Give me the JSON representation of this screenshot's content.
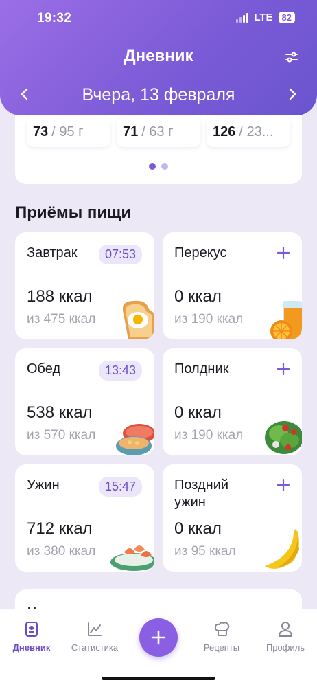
{
  "status": {
    "time": "19:32",
    "network": "LTE",
    "battery": "82"
  },
  "header": {
    "title": "Дневник",
    "date": "Вчера,  13 февраля"
  },
  "summary": {
    "nutrients": [
      {
        "value": "73",
        "goal": "/ 95 г"
      },
      {
        "value": "71",
        "goal": "/ 63 г"
      },
      {
        "value": "126",
        "goal": "/ 23..."
      }
    ]
  },
  "section_title": "Приёмы пищи",
  "meals": [
    {
      "name": "Завтрак",
      "time": "07:53",
      "kcal": "188 ккал",
      "of": "из 475 ккал",
      "picture": "toast-egg"
    },
    {
      "name": "Перекус",
      "time": "",
      "kcal": "0 ккал",
      "of": "из 190 ккал",
      "picture": "orange-juice"
    },
    {
      "name": "Обед",
      "time": "13:43",
      "kcal": "538 ккал",
      "of": "из 570 ккал",
      "picture": "soup-bowl"
    },
    {
      "name": "Полдник",
      "time": "",
      "kcal": "0 ккал",
      "of": "из 190 ккал",
      "picture": "salad"
    },
    {
      "name": "Ужин",
      "time": "15:47",
      "kcal": "712 ккал",
      "of": "из 380 ккал",
      "picture": "shrimp-plate"
    },
    {
      "name": "Поздний ужин",
      "time": "",
      "kcal": "0 ккал",
      "of": "из 95 ккал",
      "picture": "banana"
    }
  ],
  "peek": {
    "text": "Н"
  },
  "tabbar": {
    "diary": "Дневник",
    "stats": "Статистика",
    "recipes": "Рецепты",
    "profile": "Профиль"
  },
  "colors": {
    "accent": "#7a5ad6",
    "background": "#ece8f6"
  }
}
